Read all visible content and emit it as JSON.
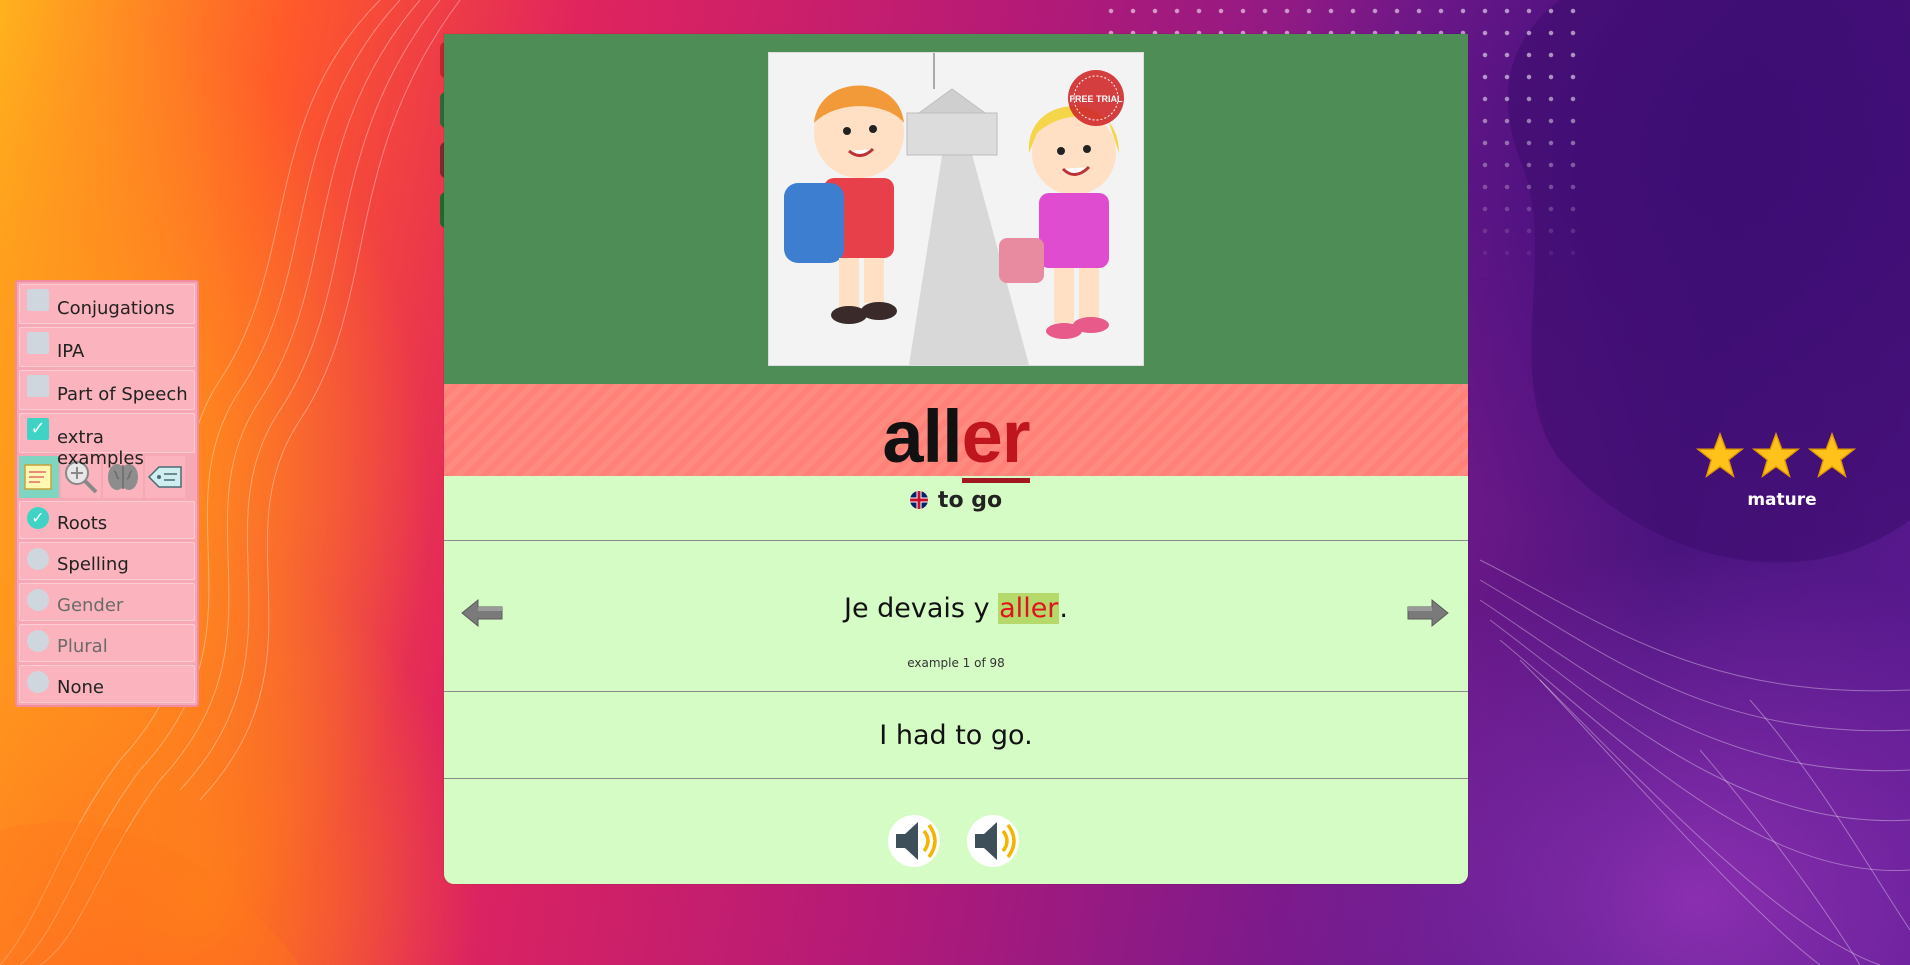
{
  "options": {
    "checkboxes": [
      {
        "label": "Conjugations",
        "checked": false
      },
      {
        "label": "IPA",
        "checked": false
      },
      {
        "label": "Part of Speech",
        "checked": false
      },
      {
        "label": "extra examples",
        "checked": true
      }
    ],
    "tools": [
      {
        "icon": "notes-icon",
        "active": true
      },
      {
        "icon": "zoom-in-icon",
        "active": false
      },
      {
        "icon": "brain-icon",
        "active": false
      },
      {
        "icon": "tag-icon",
        "active": false
      }
    ],
    "radios": [
      {
        "label": "Roots",
        "selected": true,
        "enabled": true
      },
      {
        "label": "Spelling",
        "selected": false,
        "enabled": true
      },
      {
        "label": "Gender",
        "selected": false,
        "enabled": false
      },
      {
        "label": "Plural",
        "selected": false,
        "enabled": false
      },
      {
        "label": "None",
        "selected": false,
        "enabled": true
      }
    ]
  },
  "card": {
    "image_badge": "FREE TRIAL",
    "word": {
      "stem": "all",
      "ending": "er"
    },
    "meaning": {
      "flag": "uk-flag-icon",
      "text": "to go"
    },
    "example": {
      "before": "Je devais y ",
      "highlight": "aller",
      "after": ".",
      "counter": "example 1 of 98"
    },
    "translation": "I had to go.",
    "audio": [
      "speaker-icon",
      "speaker-icon"
    ]
  },
  "rating": {
    "stars": 3,
    "label": "mature"
  },
  "colors": {
    "hero_bg": "#4e8d55",
    "word_band": "#ff8a80",
    "card_bg": "#d6fcc6",
    "accent_teal": "#3fd3c6",
    "star": "#ffc21a",
    "ending_red": "#c0141f"
  }
}
